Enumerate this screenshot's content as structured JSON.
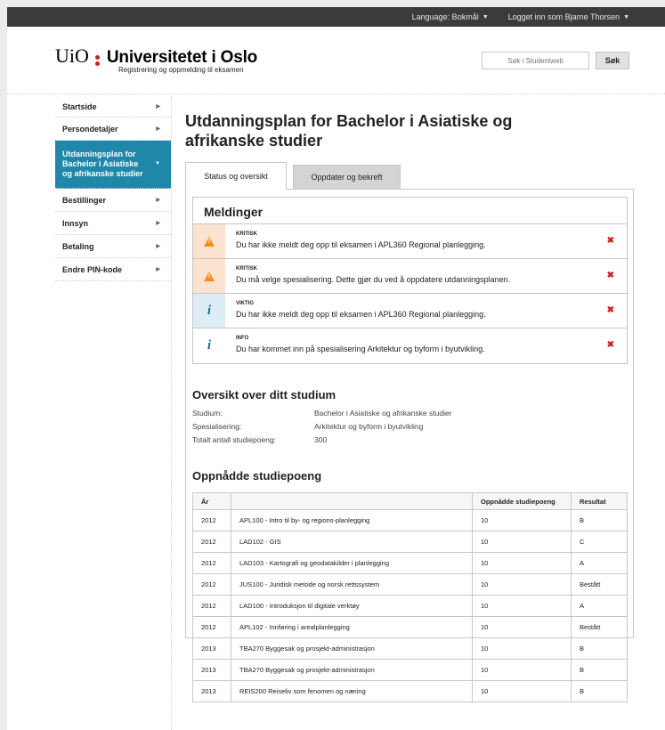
{
  "topbar": {
    "language": "Language: Bokmål",
    "login": "Logget inn som Bjarne Thorsen"
  },
  "header": {
    "logo_uio": "UiO",
    "logo_name": "Universitetet i Oslo",
    "subtitle": "Registrering og oppmelding til eksamen",
    "search_placeholder": "Søk i Studentweb",
    "search_button": "Søk",
    "brand_red": "#d01c1f"
  },
  "sidebar": {
    "active_color": "#1f87a8",
    "items": [
      {
        "label": "Startside"
      },
      {
        "label": "Persondetaljer"
      },
      {
        "label": "Utdanningsplan for Bachelor i Asiatiske og afrikanske studier"
      },
      {
        "label": "Bestillinger"
      },
      {
        "label": "Innsyn"
      },
      {
        "label": "Betaling"
      },
      {
        "label": "Endre PIN-kode"
      }
    ]
  },
  "main": {
    "title": "Utdanningsplan for Bachelor i Asiatiske og afrikanske studier",
    "tabs": [
      {
        "label": "Status og oversikt"
      },
      {
        "label": "Oppdater og bekreft"
      }
    ],
    "messages": {
      "heading": "Meldinger",
      "items": [
        {
          "level": "KRITISK",
          "icon": "warning-icon",
          "text": "Du har ikke meldt deg opp til eksamen i APL360 Regional planlegging."
        },
        {
          "level": "KRITISK",
          "icon": "warning-icon",
          "text": "Du må velge spesialisering. Dette gjør du ved å oppdatere utdanningsplanen."
        },
        {
          "level": "VIKTIG",
          "icon": "info-icon",
          "text": "Du har ikke meldt deg opp til eksamen i APL360 Regional planlegging."
        },
        {
          "level": "INFO",
          "icon": "info-icon",
          "text": "Du har kommet inn på spesialisering Arkitektur og byform i byutvikling."
        }
      ]
    },
    "overview": {
      "heading": "Oversikt over ditt studium",
      "rows": [
        {
          "key": "Studium:",
          "value": "Bachelor i Asiatiske og afrikanske studier"
        },
        {
          "key": "Spesialisering:",
          "value": "Arkitektur og byform i byutvikling"
        },
        {
          "key": "Totalt antall studiepoeng:",
          "value": "300"
        }
      ]
    },
    "points": {
      "heading": "Oppnådde studiepoeng",
      "columns": [
        "År",
        "",
        "Oppnådde studiepoeng",
        "Resultat"
      ],
      "rows": [
        [
          "2012",
          "APL100 - Intro til by- og regions-planlegging",
          "10",
          "B"
        ],
        [
          "2012",
          "LAD102 - GIS",
          "10",
          "C"
        ],
        [
          "2012",
          "LAD103 - Kartografi og geodatakilder i planlegging",
          "10",
          "A"
        ],
        [
          "2012",
          "JUS100 - Juridisk metode og norsk rettssystem",
          "10",
          "Bestått"
        ],
        [
          "2012",
          "LAD100 - Introduksjon til digitale verktøy",
          "10",
          "A"
        ],
        [
          "2012",
          "APL102 - Innføring i arealplanlegging",
          "10",
          "Bestått"
        ],
        [
          "2013",
          "TBA270 Byggesak og prosjekt-administrasjon",
          "10",
          "B"
        ],
        [
          "2013",
          "TBA270 Byggesak og prosjekt-administrasjon",
          "10",
          "B"
        ],
        [
          "2013",
          "REIS200 Reiseliv som fenomen og næring",
          "10",
          "B"
        ]
      ]
    }
  }
}
